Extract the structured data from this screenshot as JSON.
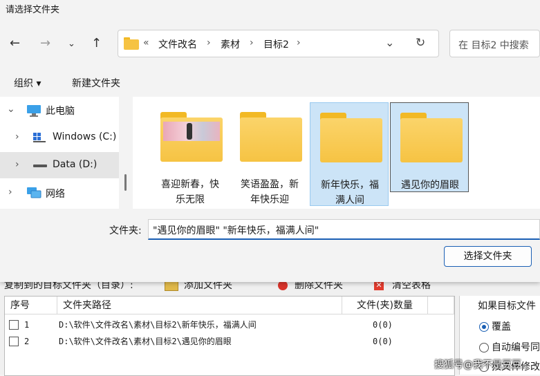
{
  "dialog": {
    "title": "请选择文件夹",
    "breadcrumb": [
      "«",
      "文件改名",
      "素材",
      "目标2"
    ],
    "search_placeholder": "在 目标2 中搜索",
    "organize_label": "组织 ▾",
    "new_folder_label": "新建文件夹",
    "nav": [
      {
        "label": "此电脑",
        "icon": "monitor-icon"
      },
      {
        "label": "Windows (C:)",
        "icon": "windows-drive-icon"
      },
      {
        "label": "Data (D:)",
        "icon": "drive-icon"
      },
      {
        "label": "网络",
        "icon": "network-icon"
      }
    ],
    "folders": [
      {
        "line1": "喜迎新春，快",
        "line2": "乐无限",
        "selected": false
      },
      {
        "line1": "笑语盈盈，新",
        "line2": "年快乐迎",
        "selected": false
      },
      {
        "line1": "新年快乐，福",
        "line2": "满人间",
        "selected": true
      },
      {
        "line1": "遇见你的眉眼",
        "line2": "",
        "selected": true
      }
    ],
    "filename_label": "文件夹:",
    "filename_value": "\"遇见你的眉眼\" \"新年快乐，福满人间\"",
    "select_button": "选择文件夹"
  },
  "app": {
    "toolbar": {
      "target_label": "复制到的目标文件夹（目录）:",
      "add_label": "添加文件夹",
      "delete_label": "删除文件夹",
      "clear_label": "清空表格"
    },
    "table": {
      "headers": [
        "序号",
        "文件夹路径",
        "文件(夹)数量"
      ],
      "rows": [
        {
          "index": "1",
          "path": "D:\\软件\\文件改名\\素材\\目标2\\新年快乐，福满人间",
          "count": "0(0)"
        },
        {
          "index": "2",
          "path": "D:\\软件\\文件改名\\素材\\目标2\\遇见你的眉眼",
          "count": "0(0)"
        }
      ]
    },
    "options": {
      "heading": "如果目标文件",
      "overwrite": "覆盖",
      "auto_number": "自动编号同",
      "by_modify": "按文件修改"
    }
  },
  "watermark": "搜狐号@我不是豆豆"
}
